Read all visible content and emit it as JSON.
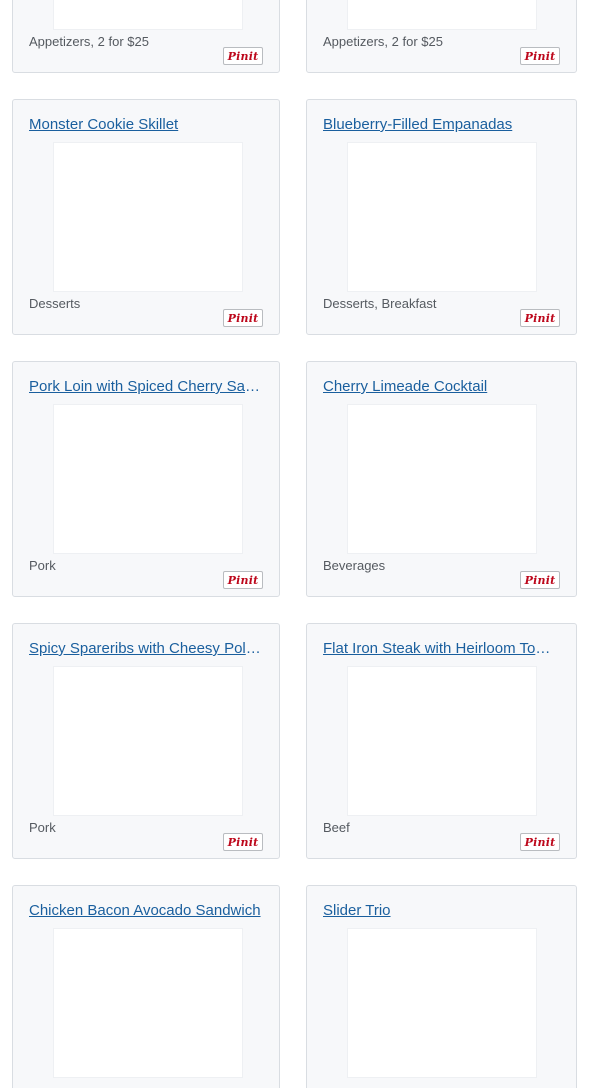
{
  "pin_button_label": "Pinit",
  "colors": {
    "link": "#1a5f9e",
    "card_bg": "#f7f8fa",
    "card_border": "#d9dde2",
    "pin_red": "#bd081c",
    "category_text": "#555a60"
  },
  "cards": [
    {
      "title": "",
      "category": "Appetizers, 2 for $25"
    },
    {
      "title": "",
      "category": "Appetizers, 2 for $25"
    },
    {
      "title": "Monster Cookie Skillet",
      "category": "Desserts"
    },
    {
      "title": "Blueberry-Filled Empanadas",
      "category": "Desserts, Breakfast"
    },
    {
      "title": "Pork Loin with Spiced Cherry Sauce",
      "category": "Pork"
    },
    {
      "title": "Cherry Limeade Cocktail",
      "category": "Beverages"
    },
    {
      "title": "Spicy Spareribs with Cheesy Polenta",
      "category": "Pork"
    },
    {
      "title": "Flat Iron Steak with Heirloom Tomatoes",
      "category": "Beef"
    },
    {
      "title": "Chicken Bacon Avocado Sandwich",
      "category": ""
    },
    {
      "title": "Slider Trio",
      "category": ""
    }
  ]
}
